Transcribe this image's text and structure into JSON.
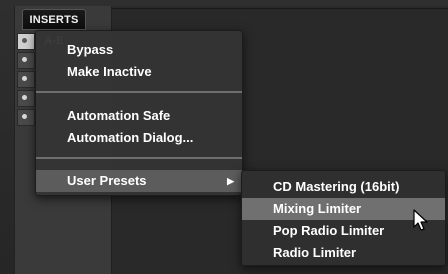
{
  "insert_panel": {
    "header": "INSERTS A-E",
    "slot_count": 5
  },
  "context_menu": {
    "items": [
      {
        "label": "Bypass"
      },
      {
        "label": "Make Inactive"
      },
      {
        "label": "Automation Safe"
      },
      {
        "label": "Automation Dialog..."
      },
      {
        "label": "User Presets",
        "highlighted": true,
        "has_submenu": true
      }
    ],
    "submenu_arrow_icon": "chevron-right-icon"
  },
  "submenu": {
    "items": [
      {
        "label": "CD Mastering (16bit)"
      },
      {
        "label": "Mixing Limiter",
        "highlighted": true
      },
      {
        "label": "Pop Radio Limiter"
      },
      {
        "label": "Radio Limiter"
      }
    ]
  },
  "colors": {
    "menu_bg": "#343434",
    "highlight": "#5c5c5c",
    "submenu_highlight": "#707070",
    "text": "#ffffff"
  }
}
